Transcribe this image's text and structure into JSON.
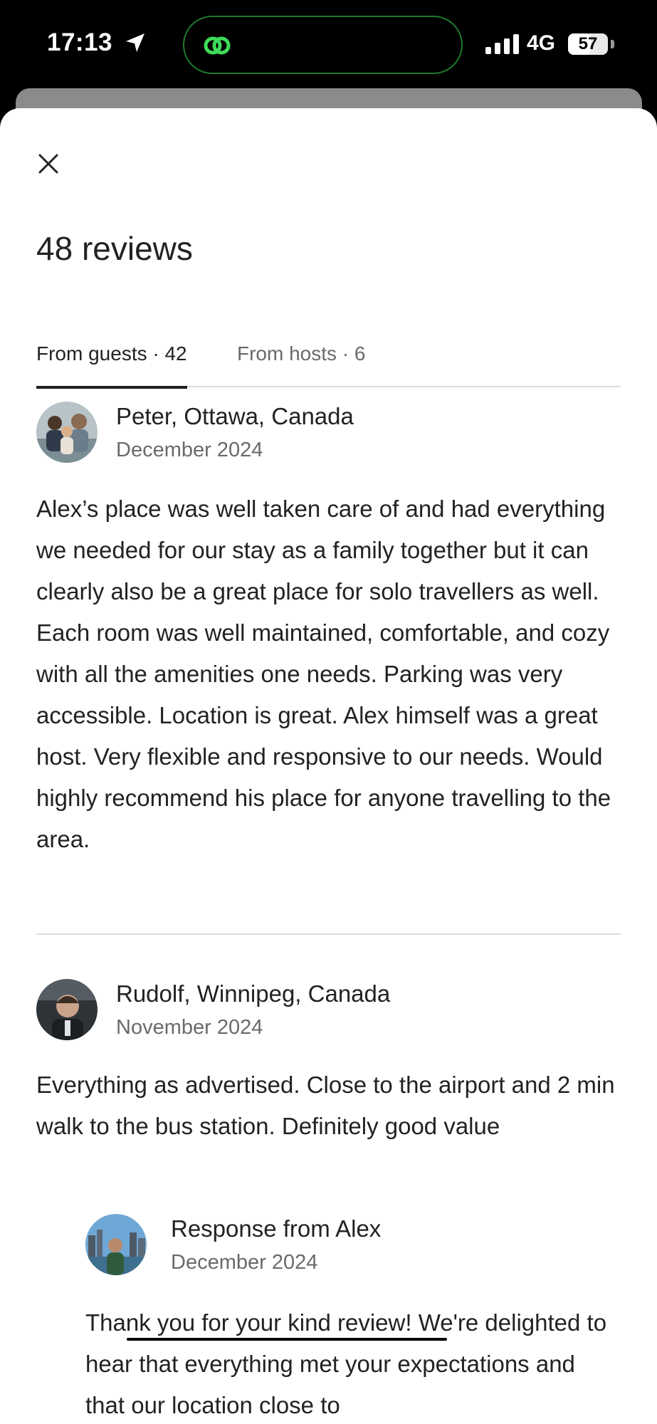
{
  "status_bar": {
    "time": "17:13",
    "network": "4G",
    "battery": "57",
    "battery_level": 0.57
  },
  "header": {
    "title": "48 reviews"
  },
  "tabs": [
    {
      "label": "From guests · 42",
      "active": true
    },
    {
      "label": "From hosts · 6",
      "active": false
    }
  ],
  "reviews": [
    {
      "name": "Peter, Ottawa, Canada",
      "date": "December 2024",
      "text": "Alex’s place was well taken care of and had everything we needed for our stay as a family together but it can clearly also be a great place for solo travellers as well. Each room was well maintained, comfortable, and cozy with all the amenities one needs. Parking was very accessible. Location is great. Alex himself was a great host. Very flexible and responsive to our needs. Would highly recommend his place for anyone travelling to the area."
    },
    {
      "name": "Rudolf, Winnipeg, Canada",
      "date": "November 2024",
      "text": "Everything as advertised. Close to the airport and 2 min walk to the bus station. Definitely good value",
      "response": {
        "name": "Response from Alex",
        "date": "December 2024",
        "text": "Thank you for your kind review! We're delighted to hear that everything met your expectations and that our location close to"
      }
    }
  ]
}
